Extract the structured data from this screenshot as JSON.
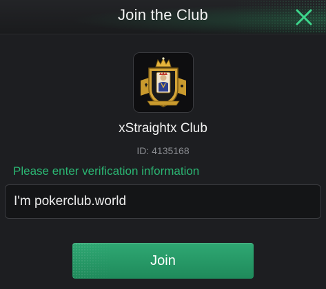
{
  "dialog": {
    "title": "Join the Club",
    "close_icon": "close-x-icon"
  },
  "club": {
    "name": "xStraightx Club",
    "id_text": "ID: 4135168",
    "logo": "king-card-crest-logo"
  },
  "form": {
    "prompt": "Please enter verification information",
    "input_value": "I'm pokerclub.world"
  },
  "actions": {
    "join_label": "Join"
  },
  "colors": {
    "accent": "#2bb673",
    "button": "#27996a",
    "background": "#1d1e21"
  }
}
